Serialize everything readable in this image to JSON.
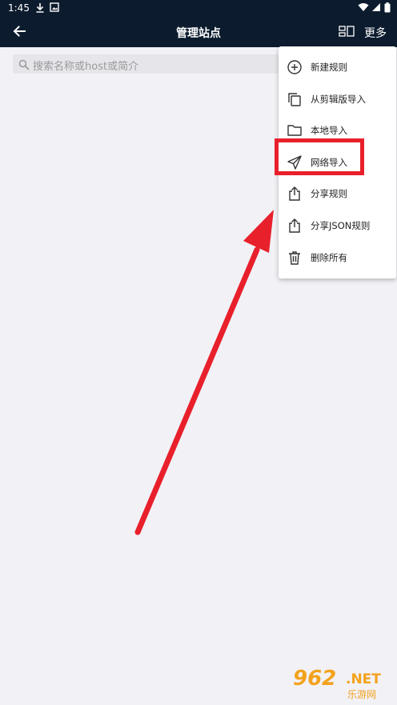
{
  "status_bar": {
    "time": "1:45",
    "left_icons": [
      "download-icon",
      "image-icon"
    ],
    "right_icons": [
      "wifi-icon",
      "signal-icon",
      "battery-icon"
    ]
  },
  "app_bar": {
    "title": "管理站点",
    "more_label": "更多"
  },
  "search": {
    "placeholder": "搜索名称或host或简介"
  },
  "menu": {
    "items": [
      {
        "label": "新建规则",
        "icon": "add-circle-icon"
      },
      {
        "label": "从剪辑版导入",
        "icon": "copy-icon"
      },
      {
        "label": "本地导入",
        "icon": "folder-icon"
      },
      {
        "label": "网络导入",
        "icon": "send-icon"
      },
      {
        "label": "分享规则",
        "icon": "share-icon"
      },
      {
        "label": "分享JSON规则",
        "icon": "share-icon"
      },
      {
        "label": "删除所有",
        "icon": "trash-icon"
      }
    ]
  },
  "annotation": {
    "highlight_color": "#e8202b",
    "highlighted_item": "网络导入"
  },
  "watermark": {
    "number": "962",
    "suffix": ".NET",
    "caption": "乐游网"
  },
  "colors": {
    "app_bar": "#0c1c2e",
    "background": "#f2f1f6",
    "menu_bg": "#ffffff",
    "accent": "#e8202b"
  }
}
